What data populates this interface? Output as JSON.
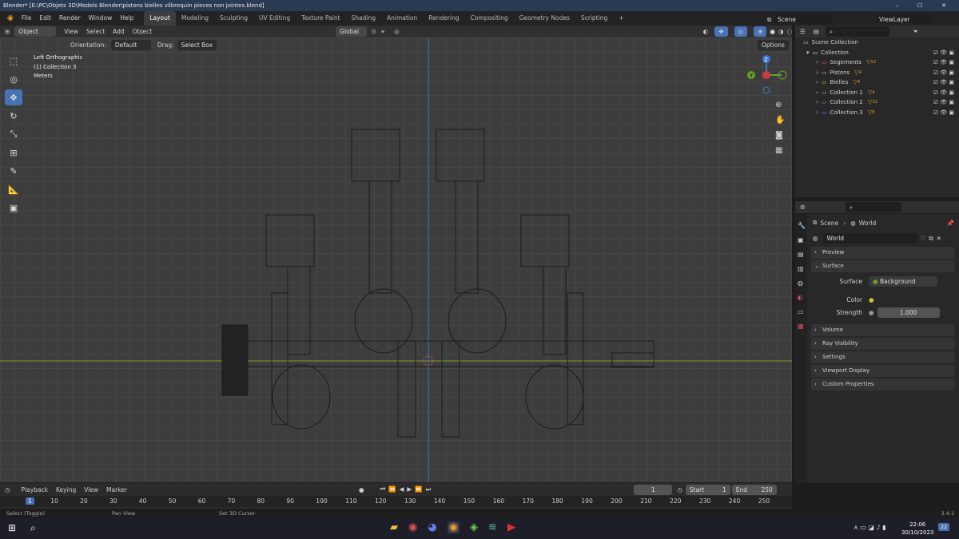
{
  "window": {
    "title": "Blender* [E:\\PC\\Objets 3D\\Models Blender\\pistons bielles vilbrequin pieces non jointes.blend]",
    "min": "–",
    "max": "☐",
    "close": "✕"
  },
  "menu": {
    "items": [
      "File",
      "Edit",
      "Render",
      "Window",
      "Help"
    ]
  },
  "workspace_tabs": [
    "Layout",
    "Modeling",
    "Sculpting",
    "UV Editing",
    "Texture Paint",
    "Shading",
    "Animation",
    "Rendering",
    "Compositing",
    "Geometry Nodes",
    "Scripting"
  ],
  "scene": {
    "label": "Scene",
    "viewlayer": "ViewLayer"
  },
  "viewport_header": {
    "mode": "Object Mode",
    "menus": [
      "View",
      "Select",
      "Add",
      "Object"
    ],
    "transform": "Global"
  },
  "tool_settings": {
    "orientation_label": "Orientation:",
    "orientation_value": "Default",
    "drag_label": "Drag:",
    "drag_value": "Select Box",
    "options": "Options"
  },
  "overlay_text": {
    "view": "Left Orthographic",
    "collection": "(1) Collection 3",
    "units": "Meters"
  },
  "gizmo": {
    "z": "Z",
    "y": "Y"
  },
  "outliner": {
    "root": "Scene Collection",
    "collection": "Collection",
    "items": [
      {
        "name": "Segements",
        "count": "12",
        "color": "#e05a5a"
      },
      {
        "name": "Pistons",
        "count": "4",
        "color": "#e09a3a"
      },
      {
        "name": "Bielles",
        "count": "4",
        "color": "#d6c23a"
      },
      {
        "name": "Collection 1",
        "count": "4",
        "color": "#5ac05a"
      },
      {
        "name": "Collection 2",
        "count": "12",
        "color": "#4a8ad6"
      },
      {
        "name": "Collection 3",
        "count": "8",
        "color": "#9a6ad6"
      }
    ]
  },
  "properties": {
    "breadcrumb_scene": "Scene",
    "breadcrumb_world": "World",
    "world_name": "World",
    "panels_top": [
      "Preview"
    ],
    "surface": "Surface",
    "surface_label": "Surface",
    "surface_value": "Background",
    "color_label": "Color",
    "strength_label": "Strength",
    "strength_value": "1.000",
    "panels_bottom": [
      "Volume",
      "Ray Visibility",
      "Settings",
      "Viewport Display",
      "Custom Properties"
    ]
  },
  "timeline": {
    "menus": [
      "Playback",
      "Keying",
      "View",
      "Marker"
    ],
    "current_frame": "1",
    "start_label": "Start",
    "start": "1",
    "end_label": "End",
    "end": "250",
    "ticks": [
      "1",
      "10",
      "20",
      "30",
      "40",
      "50",
      "60",
      "70",
      "80",
      "90",
      "100",
      "110",
      "120",
      "130",
      "140",
      "150",
      "160",
      "170",
      "180",
      "190",
      "200",
      "210",
      "220",
      "230",
      "240",
      "250"
    ]
  },
  "status": {
    "left": "Select (Toggle)",
    "mid": "Pan View",
    "right": "Set 3D Cursor",
    "version": "3.4.1"
  },
  "taskbar": {
    "time": "22:06",
    "date": "30/10/2023",
    "notif": "22"
  },
  "colors": {
    "accent": "#4772b3",
    "axis_x": "#c83c4a",
    "axis_y": "#6aa02a",
    "axis_z": "#3a78d6"
  }
}
